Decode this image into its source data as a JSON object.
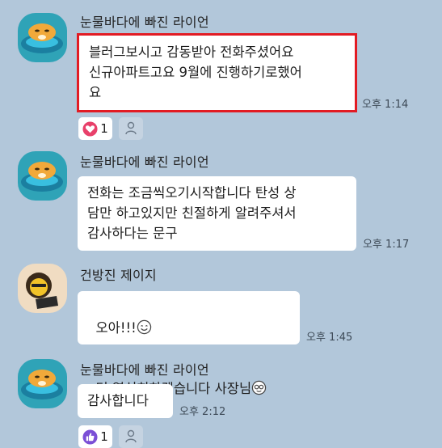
{
  "messages": [
    {
      "sender": "눈물바다에 빠진 라이언",
      "text": "블러그보시고 감동받아 전화주셨어요\n신규아파트고요 9월에 진행하기로했어\n요",
      "time": "오후 1:14",
      "reaction": {
        "icon": "heart-icon",
        "count": "1"
      }
    },
    {
      "sender": "눈물바다에 빠진 라이언",
      "text": "전화는 조금씩오기시작합니다 탄성 상\n담만 하고있지만 친절하게 알려주셔서\n감사하다는 문구",
      "time": "오후 1:17"
    },
    {
      "sender": "건방진 제이지",
      "text_line1": "오아!!!",
      "text_line2": "더 열심히하겠습니다 사장님",
      "time": "오후 1:45"
    },
    {
      "sender": "눈물바다에 빠진 라이언",
      "text": "감사합니다",
      "time": "오후 2:12",
      "reaction": {
        "icon": "thumbs-up-icon",
        "count": "1"
      }
    }
  ],
  "colors": {
    "background": "#b2c7da",
    "bubble": "#ffffff",
    "highlight": "#e21b23",
    "heart": "#e8406a",
    "thumbs": "#7b4fd6"
  }
}
